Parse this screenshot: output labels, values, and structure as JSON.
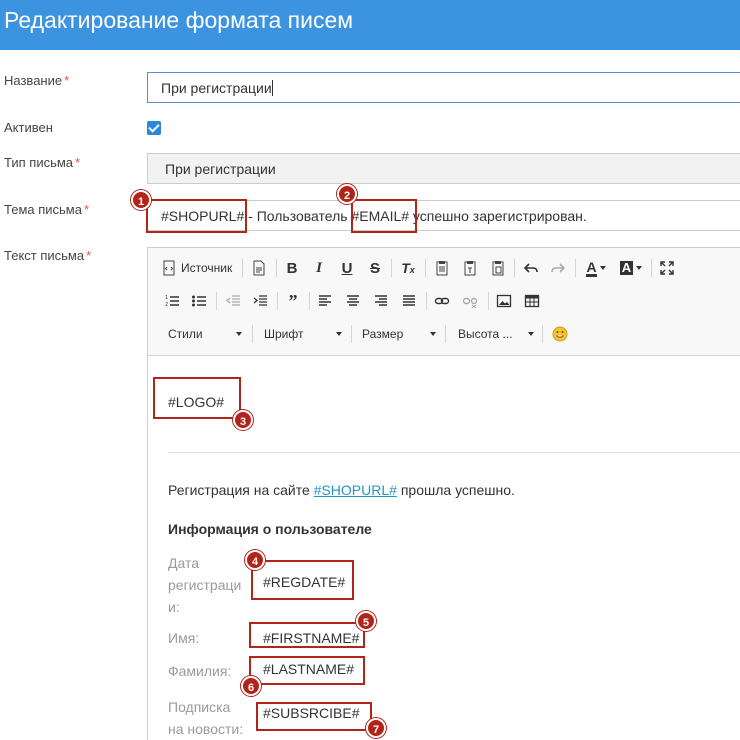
{
  "header": {
    "title": "Редактирование формата писем"
  },
  "form": {
    "name_label": "Название",
    "name_value": "При регистрации",
    "active_label": "Активен",
    "type_label": "Тип письма",
    "type_value": "При регистрации",
    "subject_label": "Тема письма",
    "subject_part1": "#SHOPURL#",
    "subject_part2": " - Пользователь ",
    "subject_part3": "#EMAIL#",
    "subject_part4": " успешно зарегистрирован.",
    "body_label": "Текст письма",
    "required_mark": "*"
  },
  "toolbar": {
    "source_label": "Источник",
    "styles_label": "Стили",
    "font_label": "Шрифт",
    "size_label": "Размер",
    "height_label": "Высота ..."
  },
  "content": {
    "logo": "#LOGO#",
    "intro_before": "Регистрация на сайте ",
    "intro_link": "#SHOPURL#",
    "intro_after": " прошла успешно.",
    "info_heading": "Информация о пользователе",
    "regdate_label": "Дата регистраци и:",
    "regdate_value": "#REGDATE#",
    "firstname_label": "Имя:",
    "firstname_value": "#FIRSTNAME#",
    "lastname_label": "Фамилия:",
    "lastname_value": "#LASTNAME#",
    "subscribe_label": "Подписка на новости:",
    "subscribe_value": "#SUBSRCIBE#"
  },
  "annotations": {
    "badge_1": "1",
    "badge_2": "2",
    "badge_3": "3",
    "badge_4": "4",
    "badge_5": "5",
    "badge_6": "6",
    "badge_7": "7",
    "color": "#b1241a"
  },
  "colors": {
    "header_bg": "#3c93e0",
    "checkbox": "#2c87d9",
    "link": "#2196c4",
    "required": "#e8533a"
  }
}
